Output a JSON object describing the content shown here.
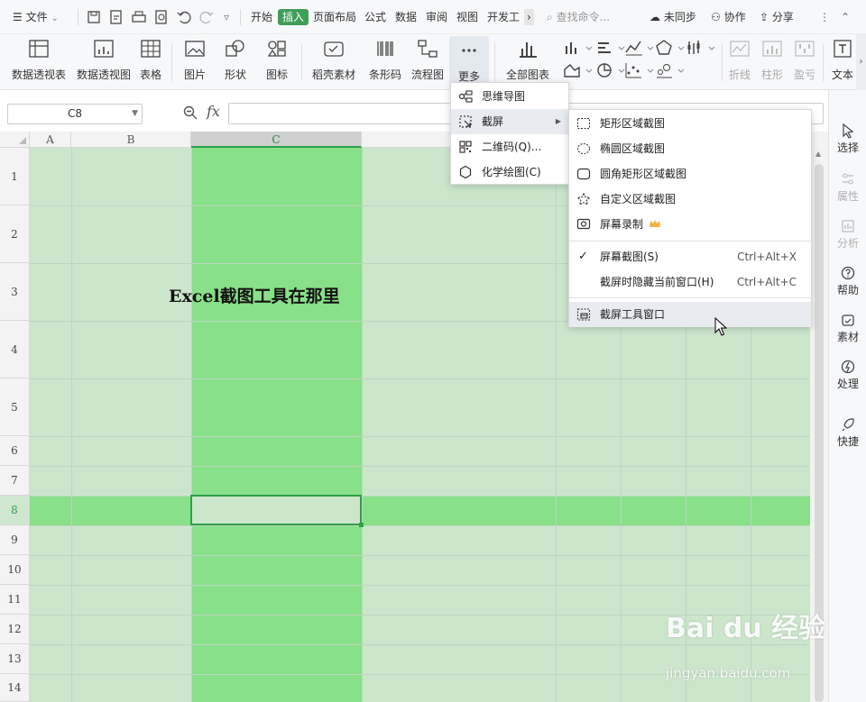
{
  "menubar": {
    "file": "文件",
    "tabs": [
      "开始",
      "插入",
      "页面布局",
      "公式",
      "数据",
      "审阅",
      "视图",
      "开发工"
    ],
    "active_tab": "插入",
    "search_placeholder": "查找命令...",
    "sync": "未同步",
    "collab": "协作",
    "share": "分享"
  },
  "ribbon": {
    "buttons": [
      "数据透视表",
      "数据透视图",
      "表格",
      "图片",
      "形状",
      "图标",
      "稻壳素材",
      "条形码",
      "流程图",
      "更多",
      "全部图表"
    ],
    "dim_buttons": [
      "折线",
      "柱形",
      "盈亏"
    ],
    "text_button": "文本"
  },
  "formula_bar": {
    "name_box": "C8",
    "fx": "fx",
    "value": ""
  },
  "sheet": {
    "columns": [
      "A",
      "B",
      "C"
    ],
    "selected_column": "C",
    "rows": [
      "1",
      "2",
      "3",
      "4",
      "5",
      "6",
      "7",
      "8",
      "9",
      "10",
      "11",
      "12",
      "13",
      "14"
    ],
    "selected_row": "8",
    "cell_text": "Excel截图工具在那里"
  },
  "more_menu": {
    "items": [
      "思维导图",
      "截屏",
      "二维码(Q)...",
      "化学绘图(C)"
    ]
  },
  "screenshot_menu": {
    "items": [
      "矩形区域截图",
      "椭圆区域截图",
      "圆角矩形区域截图",
      "自定义区域截图",
      "屏幕录制"
    ],
    "screen_capture": "屏幕截图(S)",
    "screen_capture_shortcut": "Ctrl+Alt+X",
    "hide_window_capture": "截屏时隐藏当前窗口(H)",
    "hide_window_shortcut": "Ctrl+Alt+C",
    "tool_window": "截屏工具窗口"
  },
  "sidebar": {
    "items": [
      "选择",
      "属性",
      "分析",
      "帮助",
      "素材",
      "处理",
      "快捷"
    ]
  },
  "watermark": {
    "logo": "Bai du 经验",
    "url": "jingyan.baidu.com"
  },
  "colors": {
    "accent": "#3f9e5a",
    "column_highlight": "#88e088",
    "grid_bg": "#cce6cc"
  }
}
